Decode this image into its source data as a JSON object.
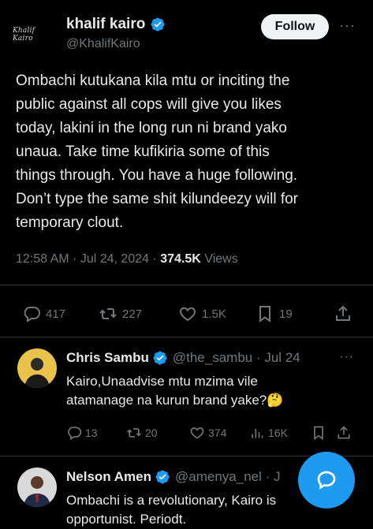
{
  "post": {
    "author_name": "khalif kairo",
    "author_handle": "@KhalifKairo",
    "avatar_signature": "Khalif Kairo",
    "follow_label": "Follow",
    "more_label": "···",
    "text": "Ombachi kutukana kila mtu or inciting the\npublic against all cops will give you likes\ntoday, lakini in the long run ni brand yako\nunaua. Take time kufikiria some of this\nthings through. You have a huge following.\nDon’t type the same shit kilundeezy will for\ntemporary clout.",
    "time": "12:58 AM",
    "sep1": "·",
    "date": "Jul 24, 2024",
    "sep2": "·",
    "views_count": "374.5K",
    "views_label": "Views",
    "stats": {
      "replies": "417",
      "reposts": "227",
      "likes": "1.5K",
      "bookmarks": "19"
    }
  },
  "replies": [
    {
      "name": "Chris Sambu",
      "handle": "@the_sambu · Jul 24",
      "more": "···",
      "text": "Kairo,Unaadvise mtu mzima vile\natamanage na kurun brand yake?🤔",
      "replies": "13",
      "reposts": "20",
      "likes": "374",
      "views": "16K"
    },
    {
      "name": "Nelson Amen",
      "handle": "@amenya_nel · J",
      "text": "Ombachi is a revolutionary, Kairo is\nopportunist. Periodt."
    }
  ],
  "colors": {
    "background": "#000000",
    "text": "#e7e9ea",
    "muted": "#71767b",
    "accent": "#1d9bf0",
    "divider": "#2f3336"
  },
  "icons": [
    "verified-badge-icon",
    "reply-icon",
    "repost-icon",
    "like-icon",
    "bookmark-icon",
    "share-icon",
    "views-icon",
    "compose-icon"
  ]
}
